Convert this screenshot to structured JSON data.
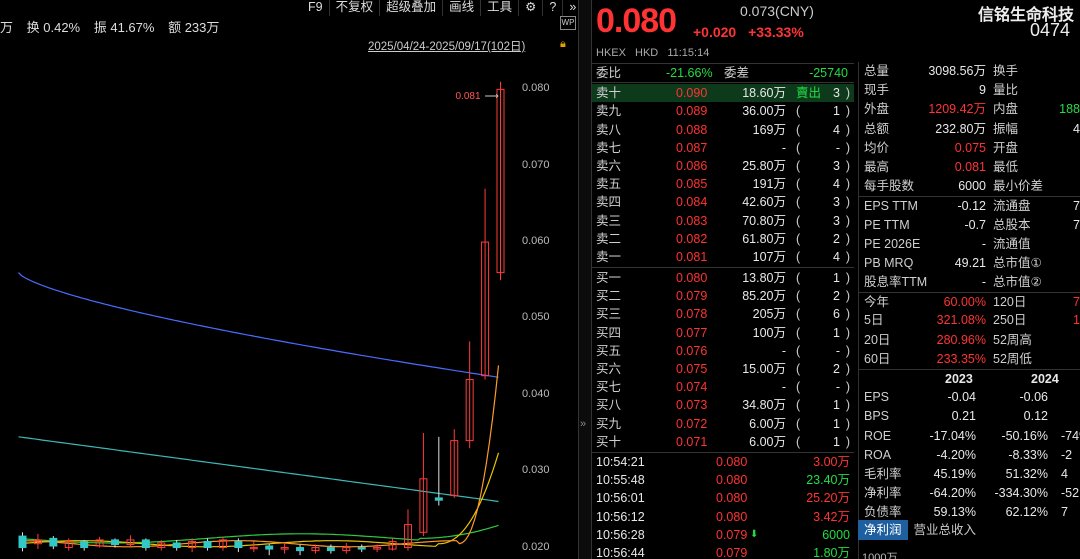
{
  "chart_header": {
    "stats": [
      "万",
      "换 0.42%",
      "振 41.67%",
      "额 233万"
    ],
    "date_range": "2025/04/24-2025/09/17(102日)",
    "toolbar": [
      "F9",
      "不复权",
      "超级叠加",
      "画线",
      "工具"
    ],
    "high_marker": "0.081"
  },
  "chart_data": {
    "type": "candlestick",
    "yticks": [
      "0.080",
      "0.070",
      "0.060",
      "0.050",
      "0.040",
      "0.030",
      "0.020"
    ],
    "ylim": [
      0.0185,
      0.0845
    ],
    "candles": [
      {
        "o": 0.0215,
        "c": 0.02,
        "h": 0.022,
        "l": 0.0195
      },
      {
        "o": 0.0205,
        "c": 0.021,
        "h": 0.0218,
        "l": 0.0198
      },
      {
        "o": 0.0212,
        "c": 0.0202,
        "h": 0.0215,
        "l": 0.0198
      },
      {
        "o": 0.02,
        "c": 0.0208,
        "h": 0.0212,
        "l": 0.0196
      },
      {
        "o": 0.0208,
        "c": 0.02,
        "h": 0.021,
        "l": 0.0196
      },
      {
        "o": 0.0202,
        "c": 0.021,
        "h": 0.0214,
        "l": 0.02
      },
      {
        "o": 0.021,
        "c": 0.0204,
        "h": 0.0212,
        "l": 0.02
      },
      {
        "o": 0.0204,
        "c": 0.021,
        "h": 0.0216,
        "l": 0.0202
      },
      {
        "o": 0.021,
        "c": 0.02,
        "h": 0.0212,
        "l": 0.0196
      },
      {
        "o": 0.02,
        "c": 0.0206,
        "h": 0.021,
        "l": 0.0196
      },
      {
        "o": 0.0206,
        "c": 0.02,
        "h": 0.021,
        "l": 0.0196
      },
      {
        "o": 0.02,
        "c": 0.0208,
        "h": 0.0212,
        "l": 0.0194
      },
      {
        "o": 0.0208,
        "c": 0.02,
        "h": 0.0212,
        "l": 0.0196
      },
      {
        "o": 0.02,
        "c": 0.021,
        "h": 0.0214,
        "l": 0.0196
      },
      {
        "o": 0.0208,
        "c": 0.02,
        "h": 0.0212,
        "l": 0.0194
      },
      {
        "o": 0.02,
        "c": 0.02,
        "h": 0.0208,
        "l": 0.0194
      },
      {
        "o": 0.0202,
        "c": 0.0198,
        "h": 0.0205,
        "l": 0.019
      },
      {
        "o": 0.0198,
        "c": 0.02,
        "h": 0.0206,
        "l": 0.0192
      },
      {
        "o": 0.02,
        "c": 0.0196,
        "h": 0.0204,
        "l": 0.019
      },
      {
        "o": 0.0196,
        "c": 0.02,
        "h": 0.0204,
        "l": 0.0192
      },
      {
        "o": 0.02,
        "c": 0.0196,
        "h": 0.0204,
        "l": 0.0192
      },
      {
        "o": 0.0196,
        "c": 0.02,
        "h": 0.0206,
        "l": 0.0192
      },
      {
        "o": 0.02,
        "c": 0.0198,
        "h": 0.0204,
        "l": 0.0194
      },
      {
        "o": 0.0198,
        "c": 0.02,
        "h": 0.0204,
        "l": 0.0194
      },
      {
        "o": 0.0198,
        "c": 0.0208,
        "h": 0.0212,
        "l": 0.0196
      },
      {
        "o": 0.02,
        "c": 0.023,
        "h": 0.025,
        "l": 0.0196
      },
      {
        "o": 0.022,
        "c": 0.029,
        "h": 0.035,
        "l": 0.0215
      },
      {
        "o": 0.0265,
        "c": 0.0262,
        "h": 0.0345,
        "l": 0.0255
      },
      {
        "o": 0.0268,
        "c": 0.034,
        "h": 0.0355,
        "l": 0.0265
      },
      {
        "o": 0.034,
        "c": 0.042,
        "h": 0.047,
        "l": 0.033
      },
      {
        "o": 0.0425,
        "c": 0.06,
        "h": 0.067,
        "l": 0.042
      },
      {
        "o": 0.056,
        "c": 0.08,
        "h": 0.081,
        "l": 0.055
      }
    ]
  },
  "quote": {
    "price": "0.080",
    "prev_close": "0.073(CNY)",
    "change": "+0.020",
    "change_pct": "+33.33%",
    "name": "信铭生命科技",
    "code": "0474",
    "exchange": "HKEX",
    "currency": "HKD",
    "time": "11:15:14"
  },
  "order_book": {
    "weibi_label": "委比",
    "weibi": "-21.66%",
    "weicha_label": "委差",
    "weicha": "-25740",
    "asks": [
      {
        "label": "卖十",
        "price": "0.090",
        "vol": "18.60万",
        "tag": "賣出",
        "n": "3"
      },
      {
        "label": "卖九",
        "price": "0.089",
        "vol": "36.00万",
        "tag": "(",
        "n": "1"
      },
      {
        "label": "卖八",
        "price": "0.088",
        "vol": "169万",
        "tag": "(",
        "n": "4"
      },
      {
        "label": "卖七",
        "price": "0.087",
        "vol": "-",
        "tag": "(",
        "n": "-"
      },
      {
        "label": "卖六",
        "price": "0.086",
        "vol": "25.80万",
        "tag": "(",
        "n": "3"
      },
      {
        "label": "卖五",
        "price": "0.085",
        "vol": "191万",
        "tag": "(",
        "n": "4"
      },
      {
        "label": "卖四",
        "price": "0.084",
        "vol": "42.60万",
        "tag": "(",
        "n": "3"
      },
      {
        "label": "卖三",
        "price": "0.083",
        "vol": "70.80万",
        "tag": "(",
        "n": "3"
      },
      {
        "label": "卖二",
        "price": "0.082",
        "vol": "61.80万",
        "tag": "(",
        "n": "2"
      },
      {
        "label": "卖一",
        "price": "0.081",
        "vol": "107万",
        "tag": "(",
        "n": "4"
      }
    ],
    "bids": [
      {
        "label": "买一",
        "price": "0.080",
        "vol": "13.80万",
        "tag": "(",
        "n": "1"
      },
      {
        "label": "买二",
        "price": "0.079",
        "vol": "85.20万",
        "tag": "(",
        "n": "2"
      },
      {
        "label": "买三",
        "price": "0.078",
        "vol": "205万",
        "tag": "(",
        "n": "6"
      },
      {
        "label": "买四",
        "price": "0.077",
        "vol": "100万",
        "tag": "(",
        "n": "1"
      },
      {
        "label": "买五",
        "price": "0.076",
        "vol": "-",
        "tag": "(",
        "n": "-"
      },
      {
        "label": "买六",
        "price": "0.075",
        "vol": "15.00万",
        "tag": "(",
        "n": "2"
      },
      {
        "label": "买七",
        "price": "0.074",
        "vol": "-",
        "tag": "(",
        "n": "-"
      },
      {
        "label": "买八",
        "price": "0.073",
        "vol": "34.80万",
        "tag": "(",
        "n": "1"
      },
      {
        "label": "买九",
        "price": "0.072",
        "vol": "6.00万",
        "tag": "(",
        "n": "1"
      },
      {
        "label": "买十",
        "price": "0.071",
        "vol": "6.00万",
        "tag": "(",
        "n": "1"
      }
    ]
  },
  "trades": [
    {
      "time": "10:54:21",
      "price": "0.080",
      "vol": "3.00万",
      "color": "red"
    },
    {
      "time": "10:55:48",
      "price": "0.080",
      "vol": "23.40万",
      "color": "green"
    },
    {
      "time": "10:56:01",
      "price": "0.080",
      "vol": "25.20万",
      "color": "red"
    },
    {
      "time": "10:56:12",
      "price": "0.080",
      "vol": "3.42万",
      "color": "red"
    },
    {
      "time": "10:56:28",
      "price": "0.079",
      "vol": "6000",
      "color": "green"
    },
    {
      "time": "10:56:44",
      "price": "0.079",
      "vol": "1.80万",
      "color": "green"
    }
  ],
  "stats": {
    "rows": [
      {
        "l1": "总量",
        "v1": "3098.56万",
        "c1": "white",
        "l2": "换手",
        "v2": "",
        "c2": "white"
      },
      {
        "l1": "现手",
        "v1": "9",
        "c1": "white",
        "l2": "量比",
        "v2": "",
        "c2": "white"
      },
      {
        "l1": "外盘",
        "v1": "1209.42万",
        "c1": "red",
        "l2": "内盘",
        "v2": "188",
        "c2": "green"
      },
      {
        "l1": "总额",
        "v1": "232.80万",
        "c1": "white",
        "l2": "振幅",
        "v2": "4",
        "c2": "white"
      },
      {
        "l1": "均价",
        "v1": "0.075",
        "c1": "red",
        "l2": "开盘",
        "v2": "",
        "c2": "white"
      },
      {
        "l1": "最高",
        "v1": "0.081",
        "c1": "red",
        "l2": "最低",
        "v2": "",
        "c2": "white"
      },
      {
        "l1": "每手股数",
        "v1": "6000",
        "c1": "white",
        "l2": "最小价差",
        "v2": "",
        "c2": "white"
      },
      {
        "l1": "EPS TTM",
        "v1": "-0.12",
        "c1": "white",
        "l2": "流通盘",
        "v2": "7",
        "c2": "white"
      },
      {
        "l1": "PE TTM",
        "v1": "-0.7",
        "c1": "white",
        "l2": "总股本",
        "v2": "7",
        "c2": "white"
      },
      {
        "l1": "PE 2026E",
        "v1": "-",
        "c1": "white",
        "l2": "流通值",
        "v2": "",
        "c2": "white"
      },
      {
        "l1": "PB MRQ",
        "v1": "49.21",
        "c1": "white",
        "l2": "总市值①",
        "v2": "",
        "c2": "white"
      },
      {
        "l1": "股息率TTM",
        "v1": "-",
        "c1": "white",
        "l2": "总市值②",
        "v2": "",
        "c2": "white"
      },
      {
        "l1": "今年",
        "v1": "60.00%",
        "c1": "red",
        "l2": "120日",
        "v2": "7",
        "c2": "red"
      },
      {
        "l1": "5日",
        "v1": "321.08%",
        "c1": "red",
        "l2": "250日",
        "v2": "1",
        "c2": "red"
      },
      {
        "l1": "20日",
        "v1": "280.96%",
        "c1": "red",
        "l2": "52周高",
        "v2": "",
        "c2": "white"
      },
      {
        "l1": "60日",
        "v1": "233.35%",
        "c1": "red",
        "l2": "52周低",
        "v2": "",
        "c2": "white"
      }
    ],
    "fin_years": [
      "2023",
      "2024"
    ],
    "fin_rows": [
      {
        "l": "EPS",
        "a": "-0.04",
        "b": "-0.06",
        "c": ""
      },
      {
        "l": "BPS",
        "a": "0.21",
        "b": "0.12",
        "c": ""
      },
      {
        "l": "ROE",
        "a": "-17.04%",
        "b": "-50.16%",
        "c": "-74%"
      },
      {
        "l": "ROA",
        "a": "-4.20%",
        "b": "-8.33%",
        "c": "-2"
      },
      {
        "l": "毛利率",
        "a": "45.19%",
        "b": "51.32%",
        "c": "4"
      },
      {
        "l": "净利率",
        "a": "-64.20%",
        "b": "-334.30%",
        "c": "-52"
      },
      {
        "l": "负债率",
        "a": "59.13%",
        "b": "62.12%",
        "c": "7"
      }
    ],
    "tab_active": "净利润",
    "tab_other": "营业总收入",
    "unit_note": "1000万"
  }
}
